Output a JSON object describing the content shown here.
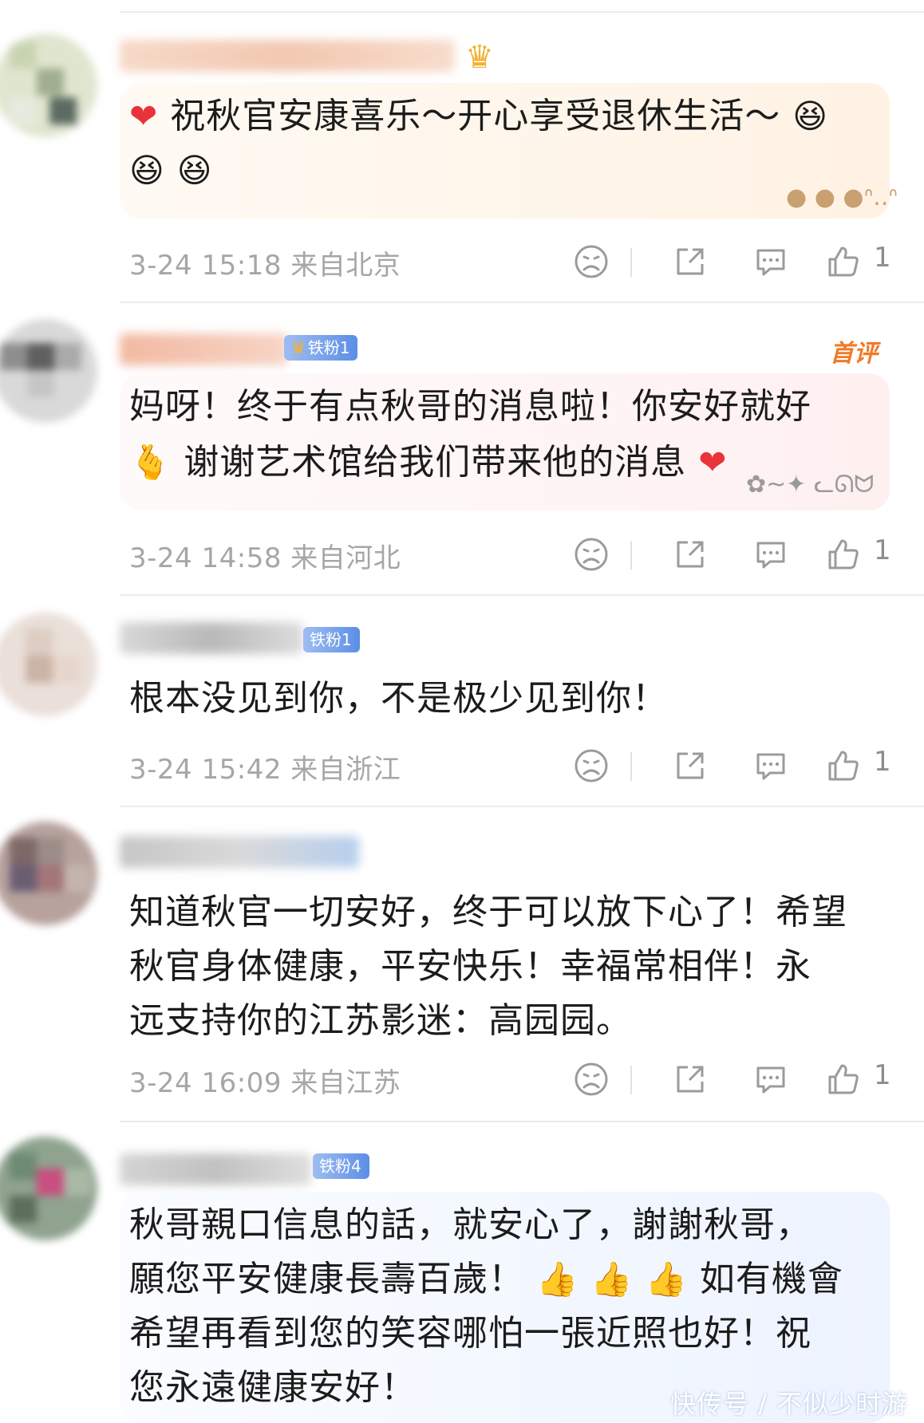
{
  "comments": [
    {
      "text_lines": [
        "祝秋官安康喜乐～开心享受退休生活～",
        ""
      ],
      "time": "3-24 15:18",
      "location": "来自北京",
      "likes": "1",
      "bubble": "orange"
    },
    {
      "badge": "铁粉1",
      "top_tag": "首评",
      "text_lines": [
        "妈呀！终于有点秋哥的消息啦！你安好就好",
        "谢谢艺术馆给我们带来他的消息"
      ],
      "time": "3-24 14:58",
      "location": "来自河北",
      "likes": "1",
      "bubble": "pink"
    },
    {
      "badge": "铁粉1",
      "text_lines": [
        "根本没见到你，不是极少见到你！"
      ],
      "time": "3-24 15:42",
      "location": "来自浙江",
      "likes": "1"
    },
    {
      "text_lines": [
        "知道秋官一切安好，终于可以放下心了！希望",
        "秋官身体健康，平安快乐！幸福常相伴！永",
        "远支持你的江苏影迷：高园园。"
      ],
      "time": "3-24 16:09",
      "location": "来自江苏",
      "likes": "1"
    },
    {
      "badge": "铁粉4",
      "text_lines": [
        "秋哥親口信息的話，就安心了，謝謝秋哥，",
        "願您平安健康長壽百歲！",
        "希望再看到您的笑容哪怕一張近照也好！祝",
        "您永遠健康安好！"
      ],
      "line2_tail": "如有機會",
      "bubble": "blue"
    }
  ],
  "watermark": "快传号 / 不似少时游",
  "icons": [
    "dislike-face-icon",
    "share-icon",
    "reply-icon",
    "like-thumb-icon",
    "heart-emoji",
    "laughing-emoji",
    "finger-heart-emoji",
    "thumbs-up-emoji",
    "crown-icon"
  ],
  "colors": {
    "badge": "#5b8ee6",
    "top_tag": "#f07a28",
    "meta": "#a6a6a6",
    "heart": "#e8333a"
  }
}
